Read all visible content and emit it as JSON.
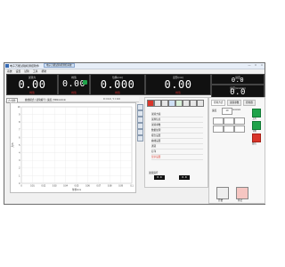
{
  "window": {
    "title": "电子万能试验机测控软件",
    "tabs": [
      "电子万能试验机测控系统"
    ],
    "controls": [
      "—",
      "□",
      "×"
    ]
  },
  "menu": [
    "系统",
    "设置",
    "试验",
    "工具",
    "帮助"
  ],
  "panels": [
    {
      "title": "试验力",
      "unit_title": "N",
      "value": "0.00",
      "unit": "峰值"
    },
    {
      "title": "峰值",
      "value": "0.00",
      "unit": "峰值"
    },
    {
      "title": "位移(mm)",
      "value": "0.000",
      "unit": "峰值"
    },
    {
      "title": "变形(mm)",
      "value": "0.00",
      "unit": "峰值"
    },
    {
      "title": "速度",
      "value": "0.0",
      "unit": "峰值"
    },
    {
      "title": "速度(mm/min)",
      "value": "0.0",
      "unit": ""
    }
  ],
  "toolbar": {
    "select": "力-位移",
    "info": "曲线模式 | 试验编号 | 速度 | 500mm/min",
    "coords": "X = 0.0 , Y = 0.0"
  },
  "chart_data": {
    "type": "line",
    "title": "",
    "xlabel": "位移/mm",
    "ylabel": "力/N",
    "x_ticks": [
      "0",
      "0.01",
      "0.02",
      "0.03",
      "0.04",
      "0.05",
      "0.06",
      "0.07",
      "0.08",
      "0.09",
      "0.1"
    ],
    "y_ticks": [
      "10",
      "9",
      "8",
      "7",
      "6",
      "5",
      "4",
      "3",
      "2",
      "1",
      "0"
    ],
    "series": [],
    "grid": true
  },
  "mid": {
    "items": [
      "试验方案",
      "试样信息",
      "试验参数",
      "数据处理",
      "报告设置",
      "曲线设置",
      "通道",
      "打印",
      "显示设置"
    ],
    "bottom_label": "试验运行",
    "readout_a": "0.0",
    "readout_b": "0.0"
  },
  "right": {
    "tabs": [
      "控制方式",
      "试验参数",
      "控制器"
    ],
    "speed_label": "速度",
    "speed_value": "10",
    "speed_unit": "mm/min",
    "start_label": "开始",
    "stop_label": "停止",
    "up_label": "上升",
    "down_label": "下降",
    "reset_label": "复位"
  }
}
